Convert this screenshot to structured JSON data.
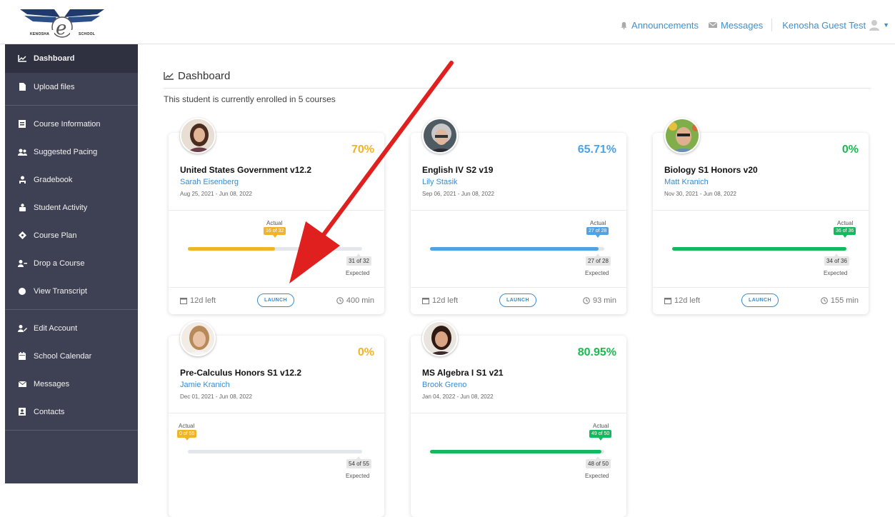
{
  "logo": {
    "left": "KENOSHA",
    "right": "SCHOOL",
    "letter": "e"
  },
  "topnav": {
    "announcements": "Announcements",
    "messages": "Messages",
    "user": "Kenosha Guest Test"
  },
  "sidebar": {
    "items": [
      {
        "label": "Dashboard",
        "icon": "chart-icon"
      },
      {
        "label": "Upload files",
        "icon": "file-icon"
      },
      {
        "label": "Course Information",
        "icon": "book-icon"
      },
      {
        "label": "Suggested Pacing",
        "icon": "users-icon"
      },
      {
        "label": "Gradebook",
        "icon": "graduation-icon"
      },
      {
        "label": "Student Activity",
        "icon": "person-icon"
      },
      {
        "label": "Course Plan",
        "icon": "compass-icon"
      },
      {
        "label": "Drop a Course",
        "icon": "user-minus-icon"
      },
      {
        "label": "View Transcript",
        "icon": "circle-icon"
      },
      {
        "label": "Edit Account",
        "icon": "user-edit-icon"
      },
      {
        "label": "School Calendar",
        "icon": "calendar-icon"
      },
      {
        "label": "Messages",
        "icon": "envelope-icon"
      },
      {
        "label": "Contacts",
        "icon": "contact-icon"
      }
    ]
  },
  "main": {
    "title": "Dashboard",
    "enrolled": "This student is currently enrolled in 5 courses"
  },
  "courses": [
    {
      "percent": "70%",
      "percent_color": "#f0b429",
      "title": "United States Government v12.2",
      "teacher": "Sarah Eisenberg",
      "dates": "Aug 25, 2021 - Jun 08, 2022",
      "actual_label": "Actual",
      "actual": "16 of 32",
      "actual_frac": 0.5,
      "bar_color": "#f0b429",
      "expected": "31 of 32",
      "expected_frac": 0.97,
      "expected_label": "Expected",
      "left": "12d left",
      "launch": "LAUNCH",
      "minutes": "400 min"
    },
    {
      "percent": "65.71%",
      "percent_color": "#4da3e8",
      "title": "English IV S2 v19",
      "teacher": "Lily Stasik",
      "dates": "Sep 06, 2021 - Jun 08, 2022",
      "actual_label": "Actual",
      "actual": "27 of 28",
      "actual_frac": 0.964,
      "bar_color": "#4da3e8",
      "expected": "27 of 28",
      "expected_frac": 0.964,
      "expected_label": "Expected",
      "left": "12d left",
      "launch": "LAUNCH",
      "minutes": "93 min"
    },
    {
      "percent": "0%",
      "percent_color": "#1db954",
      "title": "Biology S1 Honors v20",
      "teacher": "Matt Kranich",
      "dates": "Nov 30, 2021 - Jun 08, 2022",
      "actual_label": "Actual",
      "actual": "36 of 36",
      "actual_frac": 1.0,
      "bar_color": "#13b95a",
      "expected": "34 of 36",
      "expected_frac": 0.944,
      "expected_label": "Expected",
      "left": "12d left",
      "launch": "LAUNCH",
      "minutes": "155 min"
    },
    {
      "percent": "0%",
      "percent_color": "#f0b429",
      "title": "Pre-Calculus Honors S1 v12.2",
      "teacher": "Jamie Kranich",
      "dates": "Dec 01, 2021 - Jun 08, 2022",
      "actual_label": "Actual",
      "actual": "0 of 55",
      "actual_frac": 0.0,
      "bar_color": "#f0b429",
      "expected": "54 of 55",
      "expected_frac": 0.982,
      "expected_label": "Expected"
    },
    {
      "percent": "80.95%",
      "percent_color": "#1db954",
      "title": "MS Algebra I S1 v21",
      "teacher": "Brook Greno",
      "dates": "Jan 04, 2022 - Jun 08, 2022",
      "actual_label": "Actual",
      "actual": "49 of 50",
      "actual_frac": 0.98,
      "bar_color": "#13b95a",
      "expected": "48 of 50",
      "expected_frac": 0.96,
      "expected_label": "Expected"
    }
  ]
}
